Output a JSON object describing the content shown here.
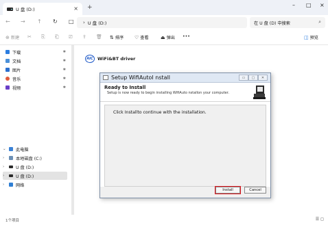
{
  "window": {
    "tab_title": "U 盘 (D:)",
    "tab_close": "×",
    "new_tab": "+",
    "minimize": "–",
    "maximize": "□",
    "close": "×"
  },
  "nav": {
    "back": "←",
    "forward": "→",
    "up": "↑",
    "refresh": "↻",
    "computer_icon": "□",
    "chevron": "›",
    "breadcrumb": "U 盘 (D:)",
    "search_placeholder": "在 U 盘 (D) 中搜索",
    "search_icon": "⌕"
  },
  "commands": {
    "new": "新建",
    "new_icon": "⊕",
    "cut_icon": "✂",
    "copy_icon": "⎘",
    "paste_icon": "⎗",
    "rename_icon": "⎚",
    "share_icon": "⇪",
    "delete_icon": "🗑",
    "sort": "排序",
    "sort_icon": "⇅",
    "view": "查看",
    "view_icon": "♡",
    "eject": "弹出",
    "eject_icon": "⏏",
    "more": "•••",
    "preview": "预览",
    "preview_icon": "◫"
  },
  "sidebar": {
    "quick": [
      {
        "label": "下载",
        "color": "#2b7de0"
      },
      {
        "label": "文档",
        "color": "#4a90d9"
      },
      {
        "label": "图片",
        "color": "#2a6fcf"
      },
      {
        "label": "音乐",
        "color": "#e05b3c"
      },
      {
        "label": "视频",
        "color": "#6a3fc8"
      }
    ],
    "pin_icon": "✱",
    "this_pc": "此电脑",
    "local_disk": "本地磁盘 (C:)",
    "usb_d": "U 盘 (D:)",
    "usb_d_selected": "U 盘 (D:)",
    "network": "网络",
    "chevron_down": "⌄",
    "chevron_right": "›"
  },
  "content": {
    "file_name": "WiFi&BT driver",
    "file_icon_text": "AIC"
  },
  "dialog": {
    "title": "Setup   WifiAutoI nstall",
    "heading": "Ready  to Install",
    "subheading": "Setup is now ready  to begin installing WifiAuto  nstallon your computer.",
    "message": "Click  Installto continue with the installation.",
    "install": "Install",
    "cancel": "Cancel",
    "ctrl_min": "▭",
    "ctrl_max": "▢",
    "ctrl_close": "✕"
  },
  "status": {
    "count": "1个项目",
    "view_icons": "☰ ◻"
  }
}
